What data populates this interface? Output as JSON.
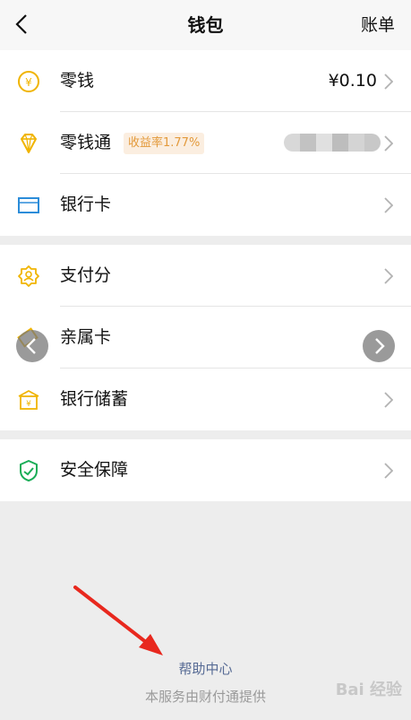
{
  "header": {
    "title": "钱包",
    "bill_label": "账单"
  },
  "group1": [
    {
      "label": "零钱",
      "value": "¥0.10"
    },
    {
      "label": "零钱通",
      "badge": "收益率1.77%"
    },
    {
      "label": "银行卡"
    }
  ],
  "group2": [
    {
      "label": "支付分"
    },
    {
      "label": "亲属卡"
    },
    {
      "label": "银行储蓄"
    }
  ],
  "group3": [
    {
      "label": "安全保障"
    }
  ],
  "help_link": "帮助中心",
  "footer_note": "本服务由财付通提供",
  "watermark": "Bai 经验",
  "colors": {
    "accent_yellow": "#f0b400",
    "link_blue": "#576b95",
    "bank_card_blue": "#2b8cd9",
    "security_green": "#19ad57",
    "annotation_red": "#e8281e"
  }
}
